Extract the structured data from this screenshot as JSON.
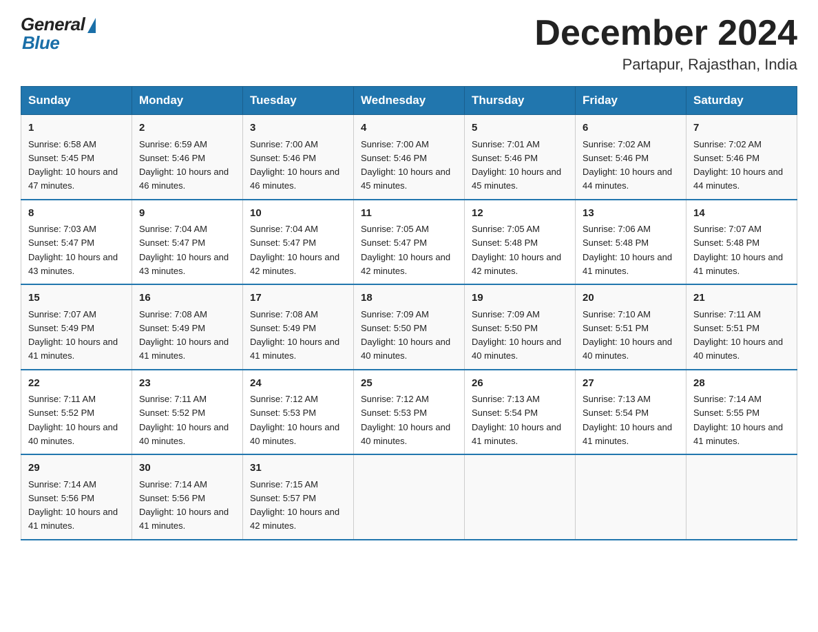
{
  "header": {
    "logo_general": "General",
    "logo_blue": "Blue",
    "month_title": "December 2024",
    "location": "Partapur, Rajasthan, India"
  },
  "days_of_week": [
    "Sunday",
    "Monday",
    "Tuesday",
    "Wednesday",
    "Thursday",
    "Friday",
    "Saturday"
  ],
  "weeks": [
    [
      {
        "day": "1",
        "sunrise": "6:58 AM",
        "sunset": "5:45 PM",
        "daylight": "10 hours and 47 minutes."
      },
      {
        "day": "2",
        "sunrise": "6:59 AM",
        "sunset": "5:46 PM",
        "daylight": "10 hours and 46 minutes."
      },
      {
        "day": "3",
        "sunrise": "7:00 AM",
        "sunset": "5:46 PM",
        "daylight": "10 hours and 46 minutes."
      },
      {
        "day": "4",
        "sunrise": "7:00 AM",
        "sunset": "5:46 PM",
        "daylight": "10 hours and 45 minutes."
      },
      {
        "day": "5",
        "sunrise": "7:01 AM",
        "sunset": "5:46 PM",
        "daylight": "10 hours and 45 minutes."
      },
      {
        "day": "6",
        "sunrise": "7:02 AM",
        "sunset": "5:46 PM",
        "daylight": "10 hours and 44 minutes."
      },
      {
        "day": "7",
        "sunrise": "7:02 AM",
        "sunset": "5:46 PM",
        "daylight": "10 hours and 44 minutes."
      }
    ],
    [
      {
        "day": "8",
        "sunrise": "7:03 AM",
        "sunset": "5:47 PM",
        "daylight": "10 hours and 43 minutes."
      },
      {
        "day": "9",
        "sunrise": "7:04 AM",
        "sunset": "5:47 PM",
        "daylight": "10 hours and 43 minutes."
      },
      {
        "day": "10",
        "sunrise": "7:04 AM",
        "sunset": "5:47 PM",
        "daylight": "10 hours and 42 minutes."
      },
      {
        "day": "11",
        "sunrise": "7:05 AM",
        "sunset": "5:47 PM",
        "daylight": "10 hours and 42 minutes."
      },
      {
        "day": "12",
        "sunrise": "7:05 AM",
        "sunset": "5:48 PM",
        "daylight": "10 hours and 42 minutes."
      },
      {
        "day": "13",
        "sunrise": "7:06 AM",
        "sunset": "5:48 PM",
        "daylight": "10 hours and 41 minutes."
      },
      {
        "day": "14",
        "sunrise": "7:07 AM",
        "sunset": "5:48 PM",
        "daylight": "10 hours and 41 minutes."
      }
    ],
    [
      {
        "day": "15",
        "sunrise": "7:07 AM",
        "sunset": "5:49 PM",
        "daylight": "10 hours and 41 minutes."
      },
      {
        "day": "16",
        "sunrise": "7:08 AM",
        "sunset": "5:49 PM",
        "daylight": "10 hours and 41 minutes."
      },
      {
        "day": "17",
        "sunrise": "7:08 AM",
        "sunset": "5:49 PM",
        "daylight": "10 hours and 41 minutes."
      },
      {
        "day": "18",
        "sunrise": "7:09 AM",
        "sunset": "5:50 PM",
        "daylight": "10 hours and 40 minutes."
      },
      {
        "day": "19",
        "sunrise": "7:09 AM",
        "sunset": "5:50 PM",
        "daylight": "10 hours and 40 minutes."
      },
      {
        "day": "20",
        "sunrise": "7:10 AM",
        "sunset": "5:51 PM",
        "daylight": "10 hours and 40 minutes."
      },
      {
        "day": "21",
        "sunrise": "7:11 AM",
        "sunset": "5:51 PM",
        "daylight": "10 hours and 40 minutes."
      }
    ],
    [
      {
        "day": "22",
        "sunrise": "7:11 AM",
        "sunset": "5:52 PM",
        "daylight": "10 hours and 40 minutes."
      },
      {
        "day": "23",
        "sunrise": "7:11 AM",
        "sunset": "5:52 PM",
        "daylight": "10 hours and 40 minutes."
      },
      {
        "day": "24",
        "sunrise": "7:12 AM",
        "sunset": "5:53 PM",
        "daylight": "10 hours and 40 minutes."
      },
      {
        "day": "25",
        "sunrise": "7:12 AM",
        "sunset": "5:53 PM",
        "daylight": "10 hours and 40 minutes."
      },
      {
        "day": "26",
        "sunrise": "7:13 AM",
        "sunset": "5:54 PM",
        "daylight": "10 hours and 41 minutes."
      },
      {
        "day": "27",
        "sunrise": "7:13 AM",
        "sunset": "5:54 PM",
        "daylight": "10 hours and 41 minutes."
      },
      {
        "day": "28",
        "sunrise": "7:14 AM",
        "sunset": "5:55 PM",
        "daylight": "10 hours and 41 minutes."
      }
    ],
    [
      {
        "day": "29",
        "sunrise": "7:14 AM",
        "sunset": "5:56 PM",
        "daylight": "10 hours and 41 minutes."
      },
      {
        "day": "30",
        "sunrise": "7:14 AM",
        "sunset": "5:56 PM",
        "daylight": "10 hours and 41 minutes."
      },
      {
        "day": "31",
        "sunrise": "7:15 AM",
        "sunset": "5:57 PM",
        "daylight": "10 hours and 42 minutes."
      },
      null,
      null,
      null,
      null
    ]
  ],
  "labels": {
    "sunrise_prefix": "Sunrise: ",
    "sunset_prefix": "Sunset: ",
    "daylight_prefix": "Daylight: "
  }
}
